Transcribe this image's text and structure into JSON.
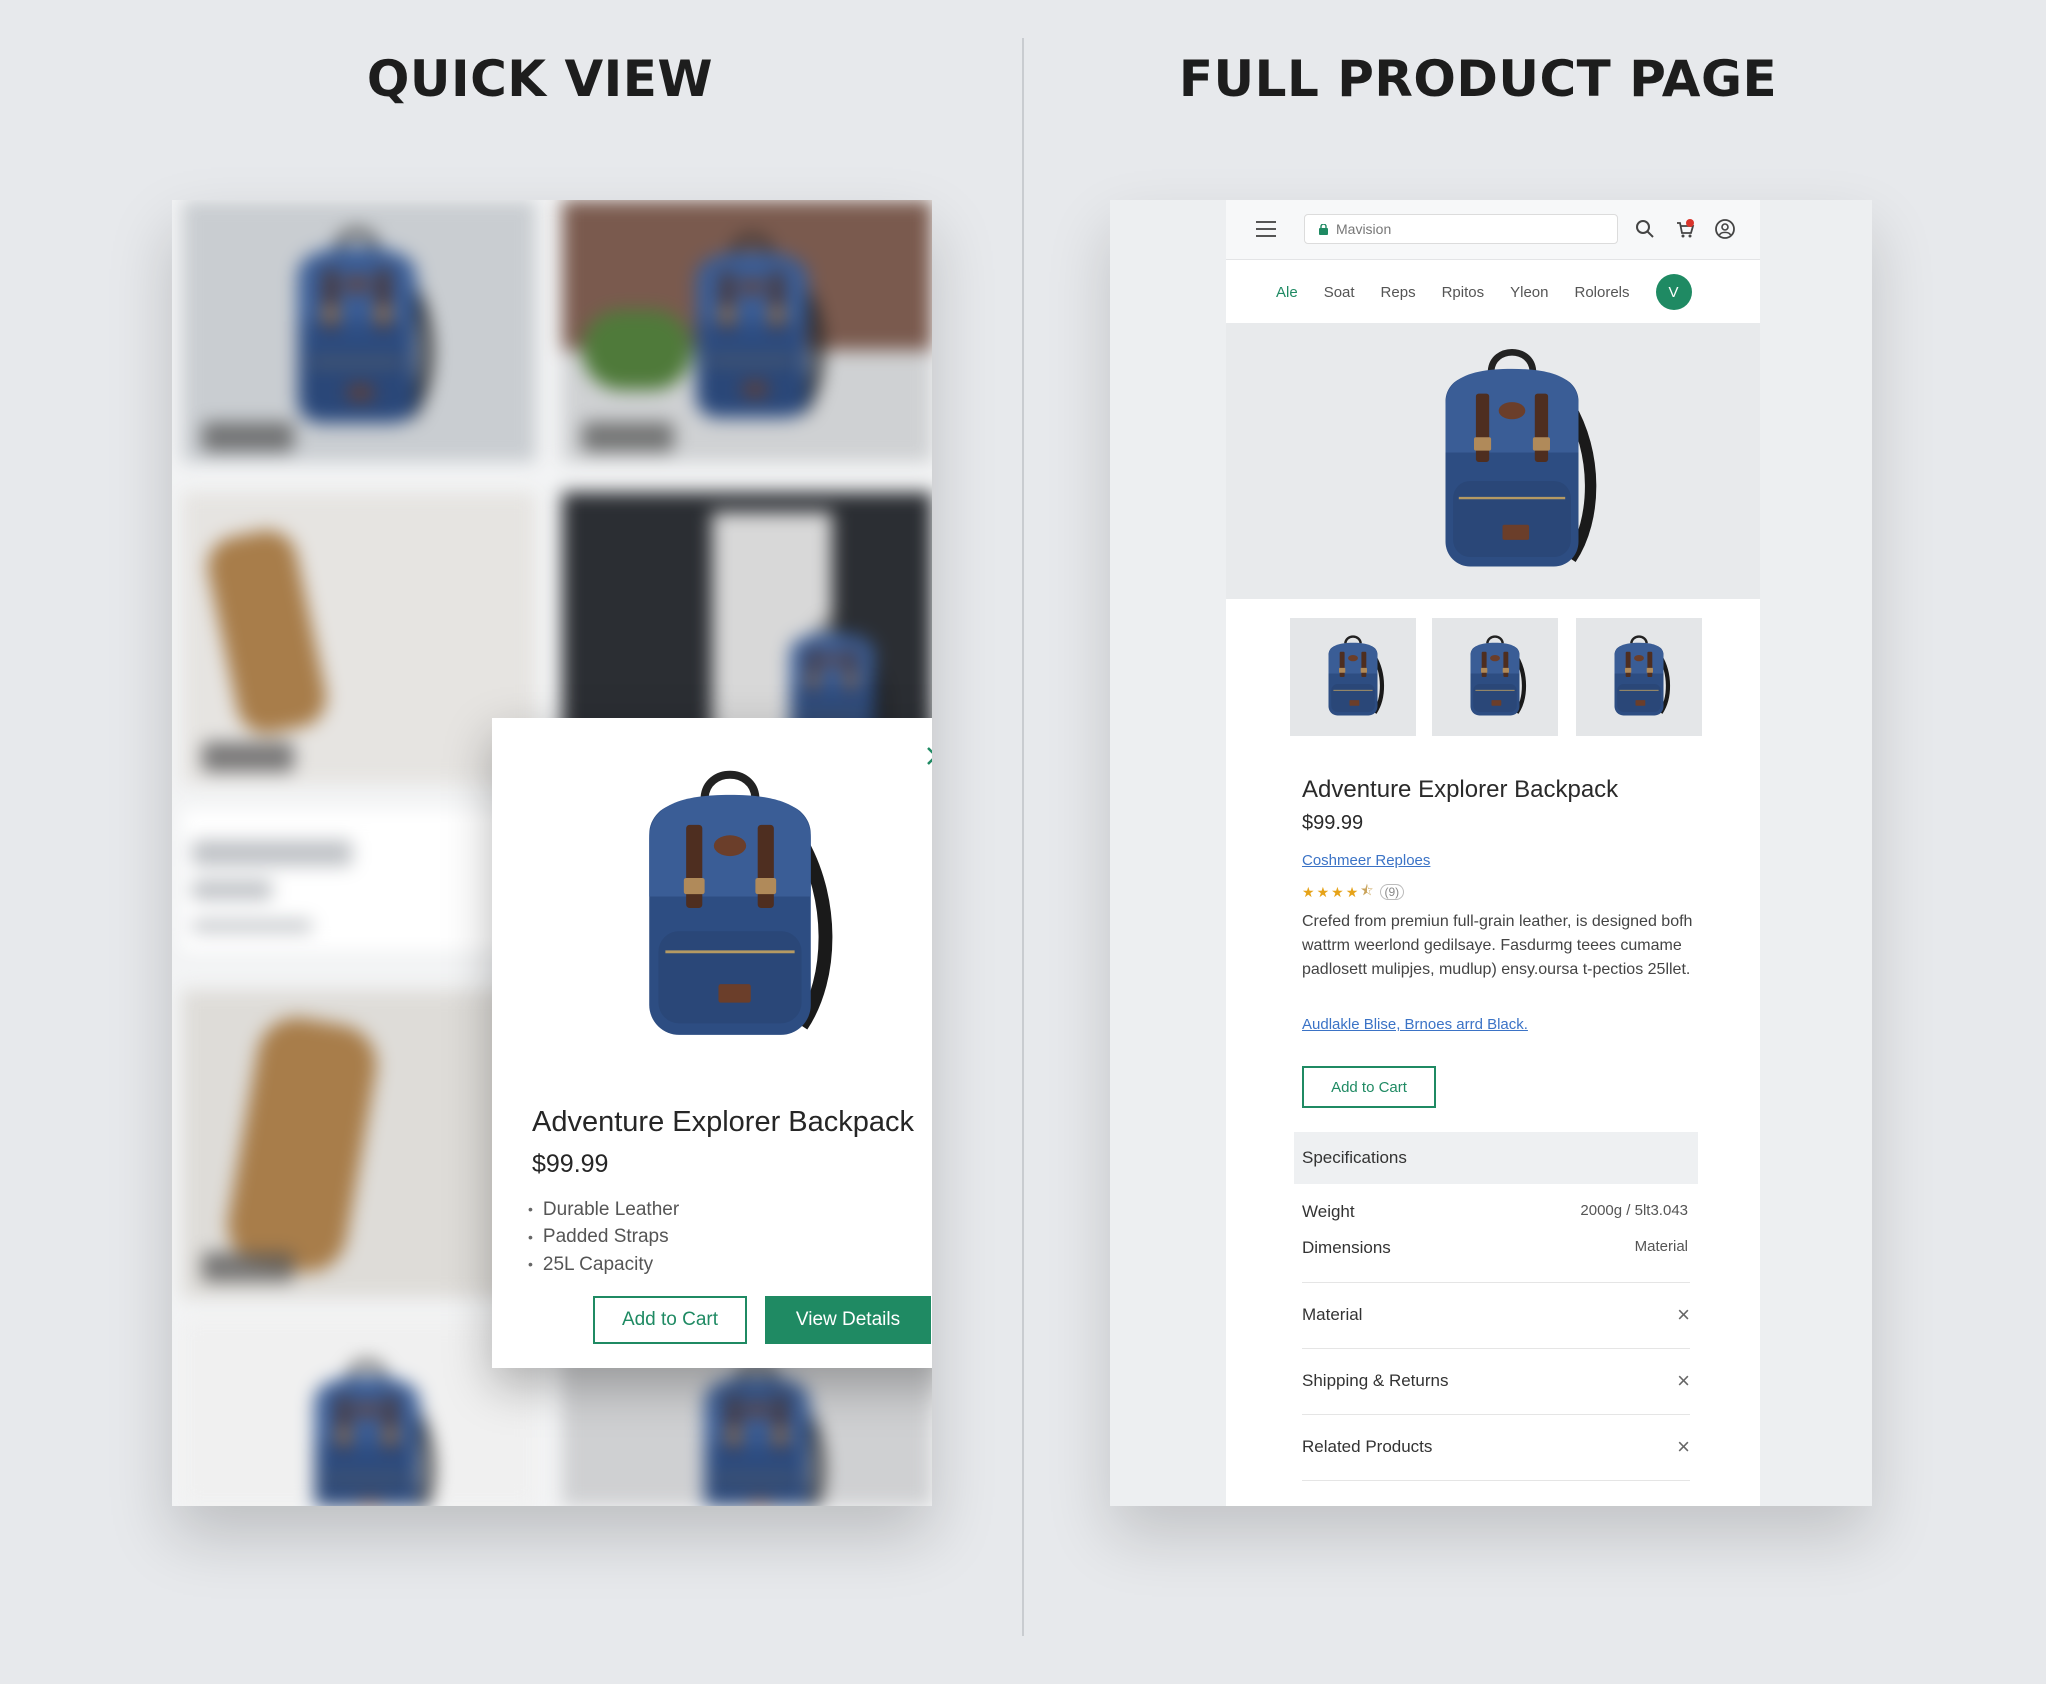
{
  "headings": {
    "left": "QUICK VIEW",
    "right": "FULL PRODUCT PAGE"
  },
  "quick_view": {
    "title": "Adventure Explorer Backpack",
    "price": "$99.99",
    "features": [
      "Durable Leather",
      "Padded Straps",
      "25L Capacity"
    ],
    "add_to_cart": "Add to Cart",
    "view_details": "View Details",
    "close_icon": "close-icon"
  },
  "product_page": {
    "url": "Mavision",
    "nav": [
      "Ale",
      "Soat",
      "Reps",
      "Rpitos",
      "Yleon",
      "Rolorels"
    ],
    "avatar_initial": "V",
    "title": "Adventure Explorer Backpack",
    "price": "$99.99",
    "reviews_link": "Coshmeer Reploes",
    "rating": 4.5,
    "rating_count": "(9)",
    "description": "Crefed from premiun full-grain leather, is designed bofh wattrm weerlond gedilsaye. Fasdurmg teees cumame padlosett mulipjes, mudlup) ensy.oursa t-pectios 25llet.",
    "colors_link": "Audlakle Blise, Brnoes arrd Black.",
    "add_to_cart": "Add to Cart",
    "spec_header": "Specifications",
    "specs": [
      {
        "label": "Weight",
        "value": "2000g / 5lt3.043"
      },
      {
        "label": "Dimensions",
        "value": "Material"
      }
    ],
    "accordion": [
      "Material",
      "Shipping & Returns",
      "Related Products"
    ]
  },
  "colors": {
    "accent": "#1f8a63",
    "backpack": "#2f4f86",
    "leather": "#5a3525"
  }
}
